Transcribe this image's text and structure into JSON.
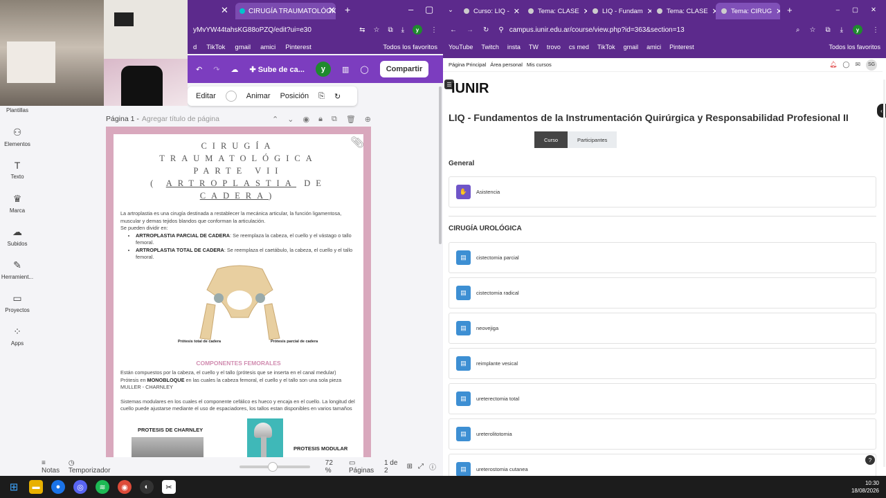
{
  "left_browser": {
    "active_tab_title": "CIRUGÍA TRAUMATOLÓGICA P",
    "url": "yMvYW44tahsKG88oPZQ/edit?ui=e30",
    "bookmarks": [
      "d",
      "TikTok",
      "gmail",
      "amici",
      "Pinterest",
      "Todos los favoritos"
    ]
  },
  "canva": {
    "toolbar": {
      "title": "Sube de ca...",
      "user_initial": "y",
      "share_label": "Compartir"
    },
    "edit_bar": {
      "edit": "Editar",
      "animate": "Animar",
      "position": "Posición"
    },
    "sidebar": [
      {
        "label": "Plantillas",
        "icon": "templates-icon"
      },
      {
        "label": "Elementos",
        "icon": "elements-icon"
      },
      {
        "label": "Texto",
        "icon": "text-icon"
      },
      {
        "label": "Marca",
        "icon": "brand-icon"
      },
      {
        "label": "Subidos",
        "icon": "uploads-icon"
      },
      {
        "label": "Herramient...",
        "icon": "tools-icon"
      },
      {
        "label": "Proyectos",
        "icon": "projects-icon"
      },
      {
        "label": "Apps",
        "icon": "apps-icon"
      }
    ],
    "page_header": {
      "label": "Página 1 -",
      "placeholder": "Agregar título de página"
    },
    "document": {
      "title_lines": [
        "CIRUGÍA",
        "TRAUMATOLÓGICA",
        "PARTE VII"
      ],
      "title_line4_open": "(",
      "title_line4_underlined": "ARTROPLASTIA",
      "title_line4_rest": "DE",
      "title_line5_underlined": "CADERA",
      "title_line5_close": ")",
      "intro": "La artroplastia es una cirugía destinada a restablecer la mecánica articular, la función ligamentosa, muscular y demas tejidos blandos que conforman la articulación.",
      "divide": "Se pueden dividir en:",
      "bullets": [
        {
          "bold": "ARTROPLASTIA PARCIAL DE CADERA",
          "text": ": Se reemplaza la cabeza, el cuello y el vástago o tallo femoral."
        },
        {
          "bold": "ARTROPLASTIA TOTAL DE CADERA",
          "text": ": Se reemplaza el caetábulo, la cabeza, el cuello y el tallo femoral."
        }
      ],
      "figure_labels": [
        "Prótesis total de cadera",
        "Prótesis parcial de cadera"
      ],
      "subheading": "COMPONENTES FEMORALES",
      "p1": "Están compuestos por la cabeza, el cuello y el tallo (prótesis que se inserta en el canal medular)",
      "p2_pre": "Prótesis en ",
      "p2_bold": "MONOBLOQUE",
      "p2_post": " en las cuales la cabeza femoral, el cuello y el tallo son una sola pieza",
      "p3": "MULLER - CHARNLEY",
      "p4": "Sistemas modulares en los cuales el componente cefálico es hueco y encaja en el cuello. La longitud del cuello puede ajustarse mediante el uso de espaciadores, los tallos estan disponibles en varios tamaños",
      "charnley": "PROTESIS DE CHARNLEY",
      "modular": "PROTESIS MODULAR"
    },
    "bottom": {
      "notes": "Notas",
      "timer": "Temporizador",
      "zoom": "72 %",
      "pages": "Páginas",
      "page_count": "1 de 2",
      "zoom_fraction": 0.42
    }
  },
  "right_browser": {
    "tabs": [
      "Curso: LIQ -",
      "Tema: CLASE",
      "LIQ - Fundam",
      "Tema: CLASE",
      "Tema: CIRUG"
    ],
    "url": "campus.iunir.edu.ar/course/view.php?id=363&section=13",
    "bookmarks": [
      "YouTube",
      "Twitch",
      "insta",
      "TW",
      "trovo",
      "cs med",
      "TikTok",
      "gmail",
      "amici",
      "Pinterest",
      "Todos los favoritos"
    ]
  },
  "moodle": {
    "nav": [
      "Página Principal",
      "Área personal",
      "Mis cursos"
    ],
    "user_initials": "SG",
    "logo": "IUNIR",
    "course_title": "LIQ - Fundamentos de la Instrumentación Quirúrgica y Responsabilidad Profesional II",
    "tabs": [
      "Curso",
      "Participantes"
    ],
    "general_heading": "General",
    "attendance": "Asistencia",
    "section_heading": "CIRUGÍA UROLÓGICA",
    "activities": [
      "cistectomia parcial",
      "cistectomia radical",
      "neovejiga",
      "reimplante vesical",
      "ureterectomia total",
      "ureterolitotomia",
      "ureterostomia cutanea"
    ]
  },
  "taskbar": {
    "time": "10:30",
    "date": "18/08/2026"
  },
  "colors": {
    "browser_purple": "#5c2a8c",
    "canva_purple": "#7c3dbf",
    "page_pink": "#d9a8bd",
    "moodle_blue": "#3d8fd3"
  }
}
